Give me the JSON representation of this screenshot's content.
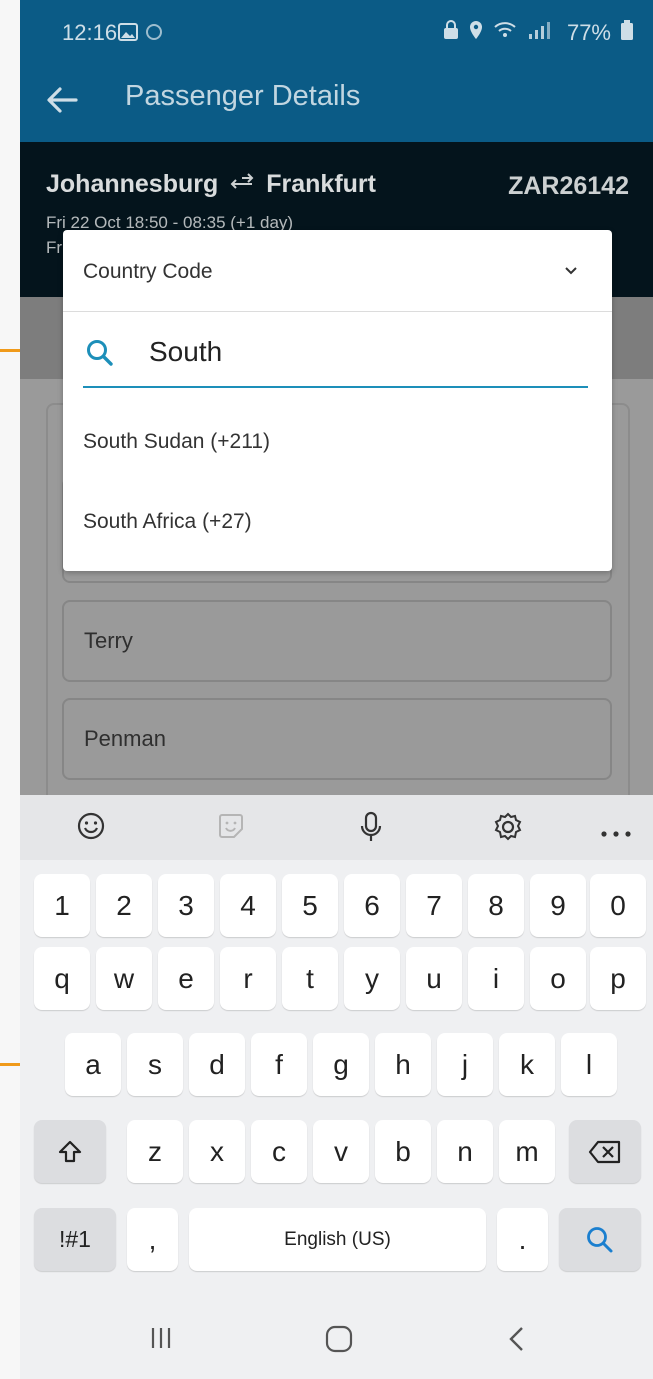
{
  "status_bar": {
    "time": "12:16",
    "battery": "77%"
  },
  "app_bar": {
    "title": "Passenger Details"
  },
  "flight": {
    "origin": "Johannesburg",
    "destination": "Frankfurt",
    "price": "ZAR26142",
    "time_line": "Fri 22 Oct  18:50 - 08:35 (+1 day)",
    "time_line_2": "Fr"
  },
  "form": {
    "first_name": "Terry",
    "last_name": "Penman"
  },
  "dropdown": {
    "title": "Country Code",
    "search_value": "South",
    "options": [
      "South Sudan (+211)",
      "South Africa (+27)"
    ]
  },
  "keyboard": {
    "row_numbers": [
      "1",
      "2",
      "3",
      "4",
      "5",
      "6",
      "7",
      "8",
      "9",
      "0"
    ],
    "row_1": [
      "q",
      "w",
      "e",
      "r",
      "t",
      "y",
      "u",
      "i",
      "o",
      "p"
    ],
    "row_2": [
      "a",
      "s",
      "d",
      "f",
      "g",
      "h",
      "j",
      "k",
      "l"
    ],
    "row_3": [
      "z",
      "x",
      "c",
      "v",
      "b",
      "n",
      "m"
    ],
    "symbols_label": "!#1",
    "comma": ",",
    "space_label": "English (US)",
    "period": "."
  },
  "colors": {
    "app_bar": "#0b5b86",
    "accent": "#1d8fb9",
    "annotation": "#f09a1a"
  }
}
